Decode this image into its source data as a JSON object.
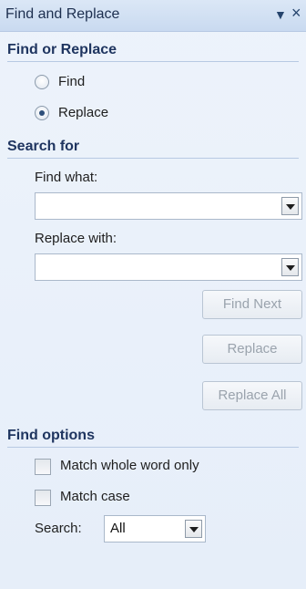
{
  "panel": {
    "title": "Find and Replace",
    "menu_icon": "dropdown-triangle",
    "close_icon": "close-x"
  },
  "find_or_replace": {
    "header": "Find or Replace",
    "options": [
      {
        "label": "Find",
        "selected": false
      },
      {
        "label": "Replace",
        "selected": true
      }
    ]
  },
  "search_for": {
    "header": "Search for",
    "find_what_label": "Find what:",
    "find_what_value": "",
    "replace_with_label": "Replace with:",
    "replace_with_value": ""
  },
  "buttons": {
    "find_next": "Find Next",
    "replace": "Replace",
    "replace_all": "Replace All",
    "enabled": false
  },
  "find_options": {
    "header": "Find options",
    "match_whole_word": {
      "label": "Match whole word only",
      "checked": false
    },
    "match_case": {
      "label": "Match case",
      "checked": false
    },
    "search_label": "Search:",
    "search_value": "All"
  },
  "colors": {
    "accent_header": "#1f3560",
    "disabled_text": "#9aa3ad",
    "titlebar": "#c9daf0"
  }
}
